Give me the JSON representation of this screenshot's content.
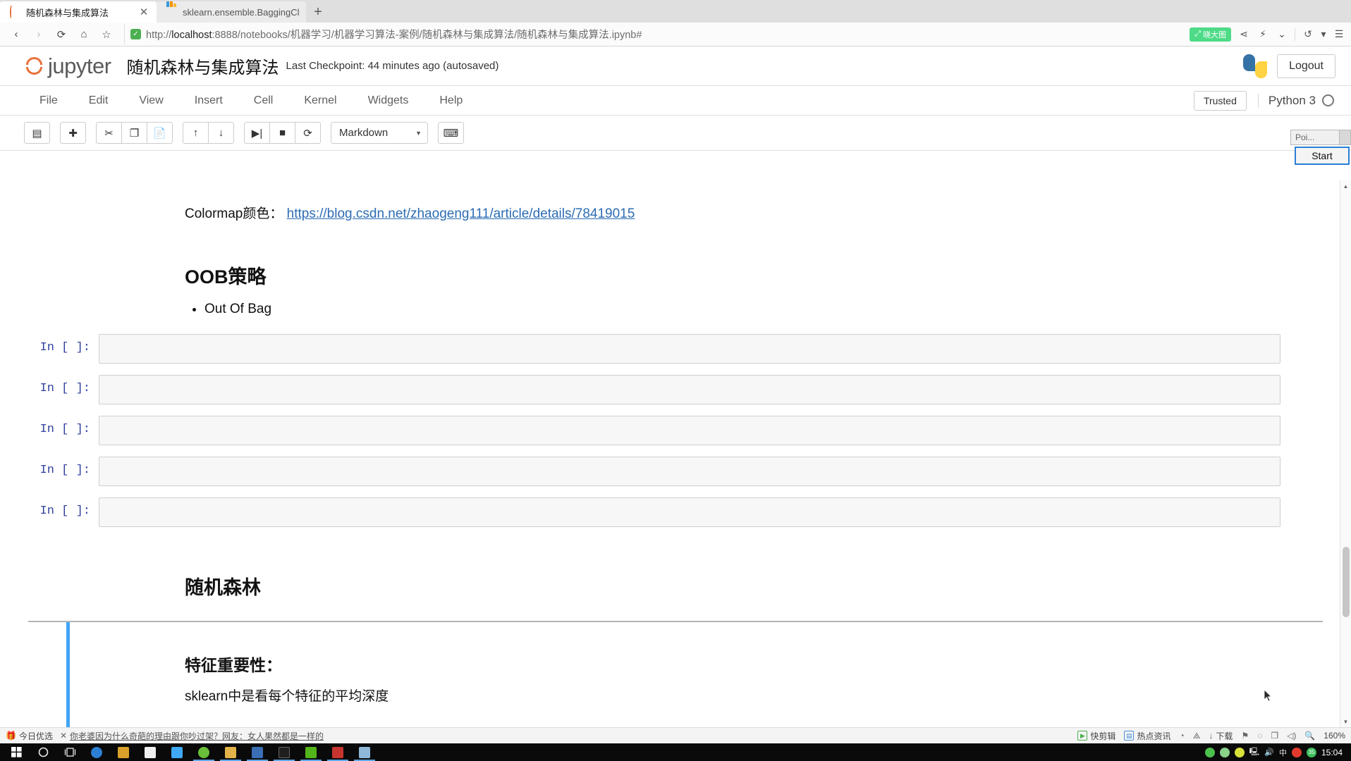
{
  "browser": {
    "tabs": [
      {
        "title": "随机森林与集成算法",
        "favicon": "jupyter-icon",
        "active": true,
        "close_label": "✕"
      },
      {
        "title": "sklearn.ensemble.BaggingCla",
        "favicon": "scikit-learn-icon",
        "active": false,
        "close_label": ""
      }
    ],
    "new_tab_label": "+",
    "nav": {
      "back_label": "‹",
      "forward_label": "›",
      "reload_label": "⟳",
      "home_label": "⌂",
      "bookmark_label": "☆",
      "shield_label": "✓",
      "url_scheme": "http://",
      "url_host": "localhost",
      "url_path": ":8888/notebooks/机器学习/机器学习算法-案例/随机森林与集成算法/随机森林与集成算法.ipynb#",
      "ext_pill": "晓大图",
      "share_label": "⋖",
      "bolt_label": "⚡",
      "chevron_label": "⌄",
      "history_label": "↺",
      "history_caret": "▾",
      "menu_label": "☰"
    }
  },
  "jupyter": {
    "logo_text": "jupyter",
    "notebook_name": "随机森林与集成算法",
    "checkpoint": "Last Checkpoint: 44 minutes ago (autosaved)",
    "logout_label": "Logout",
    "menus": [
      "File",
      "Edit",
      "View",
      "Insert",
      "Cell",
      "Kernel",
      "Widgets",
      "Help"
    ],
    "trusted_label": "Trusted",
    "kernel_name": "Python 3",
    "toolbar": {
      "save_label": "▤",
      "insert_label": "✚",
      "cut_label": "✂",
      "copy_label": "❐",
      "paste_label": "📄",
      "move_up_label": "↑",
      "move_down_label": "↓",
      "run_label": "▶|",
      "stop_label": "■",
      "restart_label": "⟳",
      "celltype_value": "Markdown",
      "celltype_caret": "▼",
      "keyboard_label": "⌨"
    },
    "tooltip": {
      "title": "Poi...",
      "button": "Start"
    }
  },
  "notebook": {
    "cells": [
      {
        "type": "markdown",
        "kind": "link-line",
        "prefix": "Colormap颜色：",
        "link_text": "https://blog.csdn.net/zhaogeng111/article/details/78419015"
      },
      {
        "type": "markdown",
        "kind": "heading2",
        "text": "OOB策略"
      },
      {
        "type": "markdown",
        "kind": "bullets",
        "items": [
          "Out Of Bag"
        ]
      },
      {
        "type": "code",
        "prompt": "In [ ]:",
        "source": ""
      },
      {
        "type": "code",
        "prompt": "In [ ]:",
        "source": ""
      },
      {
        "type": "code",
        "prompt": "In [ ]:",
        "source": ""
      },
      {
        "type": "code",
        "prompt": "In [ ]:",
        "source": ""
      },
      {
        "type": "code",
        "prompt": "In [ ]:",
        "source": ""
      },
      {
        "type": "markdown",
        "kind": "heading2",
        "text": "随机森林"
      },
      {
        "type": "markdown",
        "kind": "heading3",
        "text": "特征重要性：",
        "selected": true
      },
      {
        "type": "markdown",
        "kind": "paragraph",
        "text": "sklearn中是看每个特征的平均深度"
      }
    ],
    "scrollbar": {
      "up": "▲",
      "down": "▼"
    }
  },
  "statusbar": {
    "gift_label": "今日优选",
    "close_label": "✕",
    "news": "你老婆因为什么奇葩的理由跟你吵过架？网友：女人果然都是一样的",
    "right_items": [
      {
        "label": "快剪辑",
        "icon": "clip-icon"
      },
      {
        "label": "热点资讯",
        "icon": "news-icon"
      },
      {
        "label": "",
        "icon": "speed-icon"
      },
      {
        "label": "",
        "icon": "rocket-icon"
      },
      {
        "label": "下载",
        "icon": "download-icon"
      },
      {
        "label": "",
        "icon": "flag-icon"
      },
      {
        "label": "",
        "icon": "shield-icon"
      },
      {
        "label": "",
        "icon": "window-icon"
      },
      {
        "label": "",
        "icon": "volume-icon"
      },
      {
        "label": "",
        "icon": "search-icon"
      }
    ],
    "zoom": "160%"
  },
  "taskbar": {
    "start_label": "⊞",
    "items": [
      {
        "name": "start-button",
        "color": "#ffffff"
      },
      {
        "name": "cortana-icon",
        "color": "#e8e8e8"
      },
      {
        "name": "task-view-icon",
        "color": "#e8e8e8"
      },
      {
        "name": "edge-icon",
        "color": "#2d7fd3"
      },
      {
        "name": "microsoft-store-icon",
        "color": "#d8a12a"
      },
      {
        "name": "mail-icon",
        "color": "#f0f0f0"
      },
      {
        "name": "foxmail-icon",
        "color": "#3fa9f5"
      },
      {
        "name": "360-browser-icon",
        "color": "#6abf3a"
      },
      {
        "name": "file-explorer-icon",
        "color": "#e3b24a"
      },
      {
        "name": "powerpoint-icon",
        "color": "#3a6fb5"
      },
      {
        "name": "app-dark-icon",
        "color": "#1f1f1f"
      },
      {
        "name": "editplus-icon",
        "color": "#52b519"
      },
      {
        "name": "pycharm-icon",
        "color": "#c8352f"
      },
      {
        "name": "paint-icon",
        "color": "#8fb8d8"
      }
    ],
    "tray": [
      {
        "name": "wechat-icon",
        "color": "#4cc04c"
      },
      {
        "name": "security-icon",
        "color": "#8ad18a"
      },
      {
        "name": "360-speed-icon",
        "color": "#d8e03a"
      },
      {
        "name": "network-icon",
        "color": "#d8d8d8"
      },
      {
        "name": "volume-icon",
        "color": "#d8d8d8"
      },
      {
        "name": "ime-icon",
        "color": "#ffffff"
      },
      {
        "name": "sogou-icon",
        "color": "#e23b2e"
      },
      {
        "name": "temperature-icon",
        "color": "#3bbd5a"
      }
    ],
    "ime_label": "中",
    "battery_label": "35",
    "clock": "15:04"
  }
}
